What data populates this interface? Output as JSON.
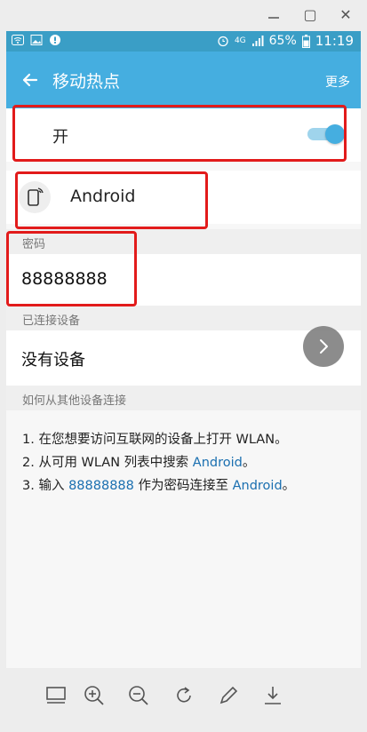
{
  "window": {
    "restore_glyph": "▢",
    "close_glyph": "✕"
  },
  "status_bar": {
    "network": "4G",
    "battery": "65%",
    "time": "11:19"
  },
  "app_bar": {
    "title": "移动热点",
    "more_label": "更多"
  },
  "hotspot": {
    "toggle_label": "开",
    "enabled": true
  },
  "device": {
    "name": "Android"
  },
  "password_section": {
    "header": "密码",
    "value": "88888888"
  },
  "connected_section": {
    "header": "已连接设备",
    "value": "没有设备"
  },
  "how_section": {
    "header": "如何从其他设备连接",
    "step1": "1. 在您想要访问互联网的设备上打开 WLAN。",
    "step2_prefix": "2. 从可用 WLAN 列表中搜索 ",
    "step2_link": "Android",
    "step2_suffix": "。",
    "step3_prefix": "3. 输入 ",
    "step3_pw": "88888888",
    "step3_mid": " 作为密码连接至 ",
    "step3_link": "Android",
    "step3_suffix": "。"
  },
  "colors": {
    "accent": "#45aee0",
    "status_bar": "#3a9ec6",
    "highlight": "#e21b1b",
    "link": "#1a6fb0"
  },
  "icons": [
    "wifi-icon",
    "gallery-icon",
    "notification-icon",
    "alarm-icon",
    "signal-icon",
    "battery-icon",
    "back-arrow-icon",
    "phone-hotspot-icon",
    "chevron-right-icon",
    "page-view-icon",
    "zoom-in-icon",
    "zoom-out-icon",
    "rotate-icon",
    "edit-icon",
    "download-icon"
  ]
}
